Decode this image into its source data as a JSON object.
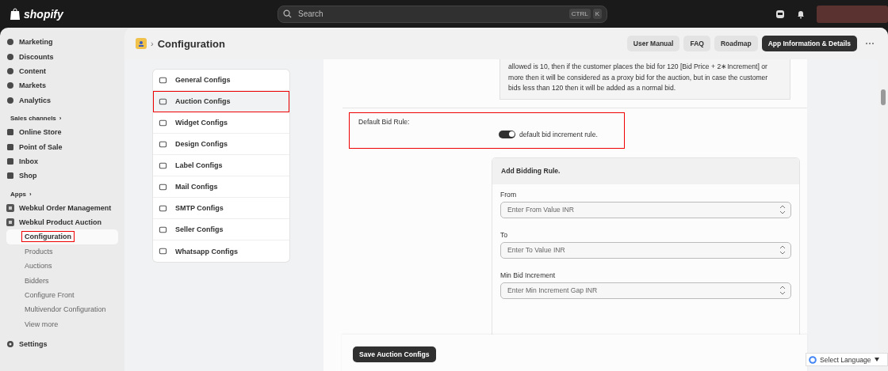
{
  "topbar": {
    "logo": "shopify",
    "search": {
      "placeholder": "Search"
    },
    "shortcut_keys": [
      "CTRL",
      "K"
    ]
  },
  "sidebar": {
    "items": [
      {
        "label": "Marketing"
      },
      {
        "label": "Discounts"
      },
      {
        "label": "Content"
      },
      {
        "label": "Markets"
      },
      {
        "label": "Analytics"
      }
    ],
    "sales_channels": {
      "title": "Sales channels",
      "chevron": "›",
      "items": [
        {
          "label": "Online Store"
        },
        {
          "label": "Point of Sale"
        },
        {
          "label": "Inbox"
        },
        {
          "label": "Shop"
        }
      ]
    },
    "apps": {
      "title": "Apps",
      "chevron": "›",
      "items": [
        {
          "label": "Webkul Order Management"
        },
        {
          "label": "Webkul Product Auction",
          "children": [
            {
              "label": "Configuration",
              "selected": true
            },
            {
              "label": "Products",
              "selected": false
            },
            {
              "label": "Auctions",
              "selected": false
            },
            {
              "label": "Bidders",
              "selected": false
            },
            {
              "label": "Configure Front",
              "selected": false
            },
            {
              "label": "Multivendor Configuration",
              "selected": false
            },
            {
              "label": "View more",
              "selected": false
            }
          ]
        }
      ]
    },
    "settings": "Settings"
  },
  "header": {
    "separator": "›",
    "title": "Configuration",
    "buttons": [
      {
        "label": "User Manual",
        "kind": "secondary"
      },
      {
        "label": "FAQ",
        "kind": "secondary"
      },
      {
        "label": "Roadmap",
        "kind": "secondary"
      },
      {
        "label": "App Information & Details",
        "kind": "primary"
      }
    ]
  },
  "config_menu": [
    {
      "label": "General Configs",
      "selected": false
    },
    {
      "label": "Auction Configs",
      "selected": true
    },
    {
      "label": "Widget Configs",
      "selected": false
    },
    {
      "label": "Design Configs",
      "selected": false
    },
    {
      "label": "Label Configs",
      "selected": false
    },
    {
      "label": "Mail Configs",
      "selected": false
    },
    {
      "label": "SMTP Configs",
      "selected": false
    },
    {
      "label": "Seller Configs",
      "selected": false
    },
    {
      "label": "Whatsapp Configs",
      "selected": false
    }
  ],
  "info_text": "allowed is 10, then if the customer places the bid for 120 [Bid Price + 2∗Increment] or more then it will be considered as a proxy bid for the auction, but in case the customer bids less than 120 then it will be added as a normal bid.",
  "default_bid_rule": {
    "label": "Default Bid Rule:",
    "on": true,
    "toggle_label": "default bid increment rule.",
    "highlighted": true
  },
  "bidding_rule": {
    "title": "Add Bidding Rule.",
    "fields": [
      {
        "label": "From",
        "placeholder": "Enter From Value INR"
      },
      {
        "label": "To",
        "placeholder": "Enter To Value INR"
      },
      {
        "label": "Min Bid Increment",
        "placeholder": "Enter Min Increment Gap INR"
      }
    ]
  },
  "save_button": "Save Auction Configs",
  "language_selector": "Select Language"
}
